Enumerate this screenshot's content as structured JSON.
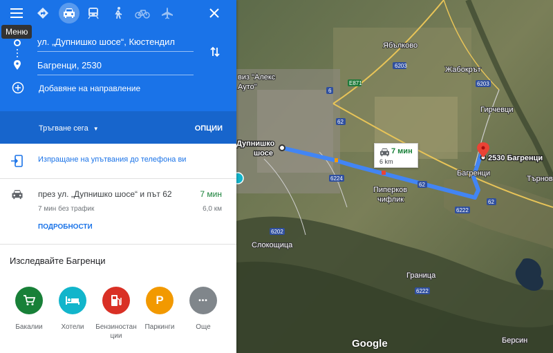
{
  "tooltip": "Меню",
  "route": {
    "origin": "ул. „Дупнишко шосе“, Кюстендил",
    "destination": "Багренци, 2530",
    "add_destination": "Добавяне на направление",
    "depart": "Тръгване сега",
    "options": "ОПЦИИ"
  },
  "send": {
    "label": "Изпращане на упътвания до телефона ви"
  },
  "result": {
    "via": "през ул. „Дупнишко шосе“ и път 62",
    "time": "7 мин",
    "traffic": "7 мин без трафик",
    "distance": "6,0 км",
    "details": "ПОДРОБНОСТИ"
  },
  "explore": {
    "title": "Изследвайте Багренци",
    "categories": [
      {
        "label": "Бакалии",
        "icon": "cart-icon",
        "color": "#188038"
      },
      {
        "label": "Хотели",
        "icon": "bed-icon",
        "color": "#12b5cb"
      },
      {
        "label": "Бензиностанции",
        "label_line1": "Бензиностан",
        "label_line2": "ции",
        "icon": "gas-icon",
        "color": "#d93025"
      },
      {
        "label": "Паркинги",
        "icon": "parking-icon",
        "glyph": "P",
        "color": "#f29900"
      },
      {
        "label": "Още",
        "icon": "more-icon",
        "glyph": "•••",
        "color": "#80868b"
      }
    ]
  },
  "map": {
    "callout_time": "7 мин",
    "callout_distance": "6 km",
    "start_label_line1": "Дупнишко",
    "start_label_line2": "шосе",
    "end_label": "2530 Багренци",
    "places": {
      "yablkovo": "Ябълково",
      "zhabokrat": "Жабокрът",
      "girchevtsi": "Гирчевци",
      "bagrentsi": "Багренци",
      "tarnovlag": "Търнов",
      "piperkov1": "Пиперков",
      "piperkov2": "чифлик",
      "slokoshtitsa": "Слокощица",
      "granitsa": "Граница",
      "bersin": "Берсин",
      "alex1": "виз \"Алекс",
      "alex2": "Ауто\""
    },
    "road_labels": [
      "6",
      "62",
      "6203",
      "6224",
      "6222",
      "6202",
      "E871"
    ],
    "google": "Google"
  },
  "colors": {
    "accent": "#1a73e8",
    "band": "#1765cc",
    "route": "#4285f4"
  }
}
